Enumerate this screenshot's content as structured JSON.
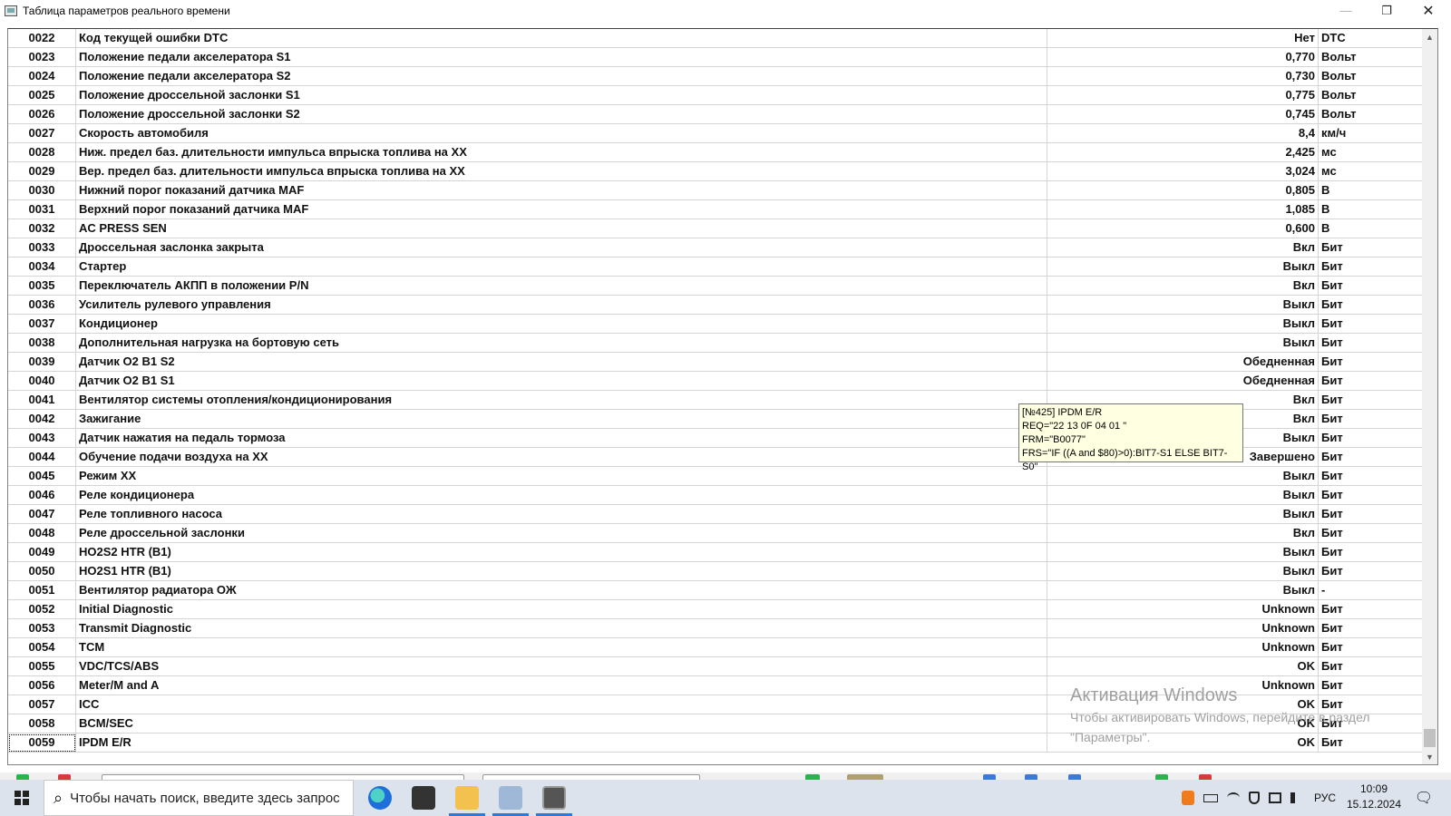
{
  "window": {
    "title": "Таблица параметров реального времени",
    "minimize_icon": "minimize-icon",
    "restore_icon": "restore-icon",
    "close_icon": "close-icon",
    "minimize_glyph": "—",
    "restore_glyph": "❐",
    "close_glyph": "✕"
  },
  "table": {
    "rows": [
      {
        "id": "0022",
        "name": "Код текущей ошибки DTC",
        "value": "Нет",
        "unit": "DTC"
      },
      {
        "id": "0023",
        "name": "Положение педали акселератора S1",
        "value": "0,770",
        "unit": "Вольт"
      },
      {
        "id": "0024",
        "name": "Положение педали акселератора S2",
        "value": "0,730",
        "unit": "Вольт"
      },
      {
        "id": "0025",
        "name": "Положение дроссельной заслонки S1",
        "value": "0,775",
        "unit": "Вольт"
      },
      {
        "id": "0026",
        "name": "Положение дроссельной заслонки S2",
        "value": "0,745",
        "unit": "Вольт"
      },
      {
        "id": "0027",
        "name": "Скорость автомобиля",
        "value": "8,4",
        "unit": "км/ч"
      },
      {
        "id": "0028",
        "name": "Ниж. предел баз. длительности импульса впрыска топлива на ХХ",
        "value": "2,425",
        "unit": "мс"
      },
      {
        "id": "0029",
        "name": "Вер. предел баз. длительности импульса впрыска топлива на ХХ",
        "value": "3,024",
        "unit": "мс"
      },
      {
        "id": "0030",
        "name": "Нижний порог показаний датчика MAF",
        "value": "0,805",
        "unit": "В"
      },
      {
        "id": "0031",
        "name": "Верхний порог показаний датчика MAF",
        "value": "1,085",
        "unit": "В"
      },
      {
        "id": "0032",
        "name": "AC PRESS SEN",
        "value": "0,600",
        "unit": "В"
      },
      {
        "id": "0033",
        "name": "Дроссельная заслонка закрыта",
        "value": "Вкл",
        "unit": "Бит"
      },
      {
        "id": "0034",
        "name": "Стартер",
        "value": "Выкл",
        "unit": "Бит"
      },
      {
        "id": "0035",
        "name": "Переключатель АКПП в положении P/N",
        "value": "Вкл",
        "unit": "Бит"
      },
      {
        "id": "0036",
        "name": "Усилитель рулевого управления",
        "value": "Выкл",
        "unit": "Бит"
      },
      {
        "id": "0037",
        "name": "Кондиционер",
        "value": "Выкл",
        "unit": "Бит"
      },
      {
        "id": "0038",
        "name": "Дополнительная нагрузка на бортовую сеть",
        "value": "Выкл",
        "unit": "Бит"
      },
      {
        "id": "0039",
        "name": "Датчик O2 B1 S2",
        "value": "Обедненная",
        "unit": "Бит"
      },
      {
        "id": "0040",
        "name": "Датчик O2 B1 S1",
        "value": "Обедненная",
        "unit": "Бит"
      },
      {
        "id": "0041",
        "name": "Вентилятор системы отопления/кондиционирования",
        "value": "Вкл",
        "unit": "Бит"
      },
      {
        "id": "0042",
        "name": "Зажигание",
        "value": "Вкл",
        "unit": "Бит"
      },
      {
        "id": "0043",
        "name": "Датчик нажатия на педаль тормоза",
        "value": "Выкл",
        "unit": "Бит"
      },
      {
        "id": "0044",
        "name": "Обучение подачи воздуха на ХХ",
        "value": "Завершено",
        "unit": "Бит"
      },
      {
        "id": "0045",
        "name": "Режим ХХ",
        "value": "Выкл",
        "unit": "Бит"
      },
      {
        "id": "0046",
        "name": "Реле кондиционера",
        "value": "Выкл",
        "unit": "Бит"
      },
      {
        "id": "0047",
        "name": "Реле топливного насоса",
        "value": "Выкл",
        "unit": "Бит"
      },
      {
        "id": "0048",
        "name": "Реле дроссельной заслонки",
        "value": "Вкл",
        "unit": "Бит"
      },
      {
        "id": "0049",
        "name": "HO2S2 HTR (B1)",
        "value": "Выкл",
        "unit": "Бит"
      },
      {
        "id": "0050",
        "name": "HO2S1 HTR (B1)",
        "value": "Выкл",
        "unit": "Бит"
      },
      {
        "id": "0051",
        "name": "Вентилятор радиатора ОЖ",
        "value": "Выкл",
        "unit": "-"
      },
      {
        "id": "0052",
        "name": "Initial Diagnostic",
        "value": "Unknown",
        "unit": "Бит"
      },
      {
        "id": "0053",
        "name": "Transmit Diagnostic",
        "value": "Unknown",
        "unit": "Бит"
      },
      {
        "id": "0054",
        "name": "TCM",
        "value": "Unknown",
        "unit": "Бит"
      },
      {
        "id": "0055",
        "name": "VDC/TCS/ABS",
        "value": "OK",
        "unit": "Бит"
      },
      {
        "id": "0056",
        "name": "Meter/M and A",
        "value": "Unknown",
        "unit": "Бит"
      },
      {
        "id": "0057",
        "name": "ICC",
        "value": "OK",
        "unit": "Бит"
      },
      {
        "id": "0058",
        "name": "BCM/SEC",
        "value": "OK",
        "unit": "Бит"
      },
      {
        "id": "0059",
        "name": "IPDM E/R",
        "value": "OK",
        "unit": "Бит"
      }
    ],
    "selected_id": "0059"
  },
  "tooltip": {
    "line1": "[№425] IPDM E/R",
    "line2": "REQ=\"22 13 0F 04 01 \"",
    "line3": "FRM=\"B0077\"",
    "line4": "FRS=\"IF ((A and $80)>0):BIT7-S1 ELSE BIT7-S0\""
  },
  "watermark": {
    "title": "Активация Windows",
    "line1": "Чтобы активировать Windows, перейдите в раздел",
    "line2": "\"Параметры\"."
  },
  "scrollbar": {
    "up_glyph": "▲",
    "down_glyph": "▼"
  },
  "taskbar": {
    "search_placeholder": "Чтобы начать поиск, введите здесь запрос",
    "search_icon_glyph": "⌕",
    "apps": [
      "edge-icon",
      "app-icon",
      "file-explorer-icon",
      "paint-icon",
      "diagnostic-app-icon"
    ],
    "tray": {
      "language": "РУС",
      "icons": [
        "notification-app-icon",
        "battery-icon",
        "network-icon",
        "security-icon",
        "device-icon",
        "volume-icon"
      ]
    },
    "time": "10:09",
    "date": "15.12.2024",
    "notification_count": "1",
    "notification_glyph": "🗨"
  },
  "colors": {
    "tooltip_bg": "#ffffe1",
    "taskbar_bg": "#dde3ec",
    "accent": "#2a7bd8"
  }
}
